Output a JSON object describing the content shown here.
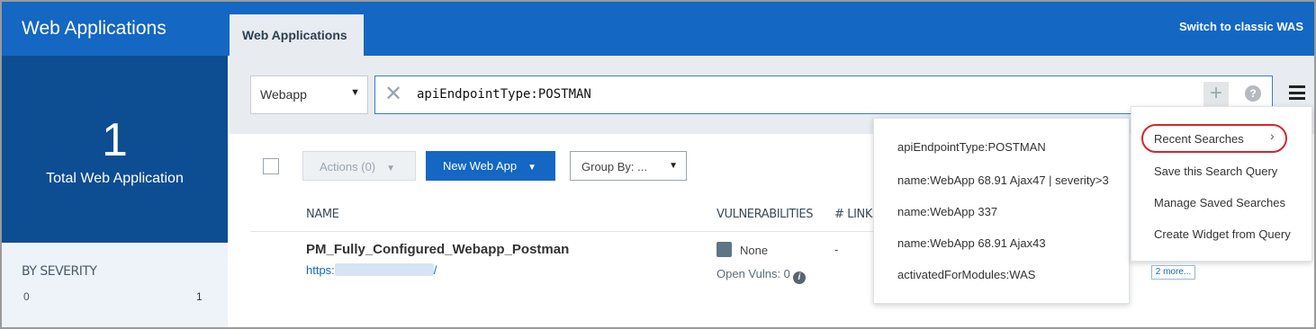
{
  "sidebar": {
    "title": "Web Applications",
    "count": "1",
    "count_label": "Total Web Application",
    "severity_title": "BY SEVERITY",
    "severity_low": "0",
    "severity_high": "1"
  },
  "header": {
    "tab_label": "Web Applications",
    "switch_label": "Switch to classic WAS"
  },
  "search": {
    "type_value": "Webapp",
    "query": "apiEndpointType:POSTMAN",
    "plus_label": "+",
    "help_label": "?"
  },
  "toolbar": {
    "actions_label": "Actions (0)",
    "new_label": "New Web App",
    "group_by_label": "Group By: ..."
  },
  "table": {
    "columns": [
      "NAME",
      "VULNERABILITIES",
      "# LINKS"
    ],
    "rows": [
      {
        "name": "PM_Fully_Configured_Webapp_Postman",
        "url_prefix": "https:",
        "url_suffix": "/",
        "vuln_status": "None",
        "open_vulns": "Open Vulns: 0",
        "links": "-"
      }
    ]
  },
  "recent_searches": [
    "apiEndpointType:POSTMAN",
    "name:WebApp 68.91 Ajax47 | severity>3",
    "name:WebApp 337",
    "name:WebApp 68.91 Ajax43",
    "activatedForModules:WAS"
  ],
  "menu": {
    "items": [
      "Recent Searches",
      "Save this Search Query",
      "Manage Saved Searches",
      "Create Widget from Query"
    ],
    "more_badge": "2 more..."
  },
  "colors": {
    "brand_blue": "#1467c2",
    "dark_blue": "#0d4d92",
    "highlight_red": "#d3262c"
  },
  "icons": [
    "close-icon",
    "plus-icon",
    "help-icon",
    "hamburger-menu-icon",
    "caret-down-icon",
    "chevron-right-icon",
    "info-icon"
  ]
}
